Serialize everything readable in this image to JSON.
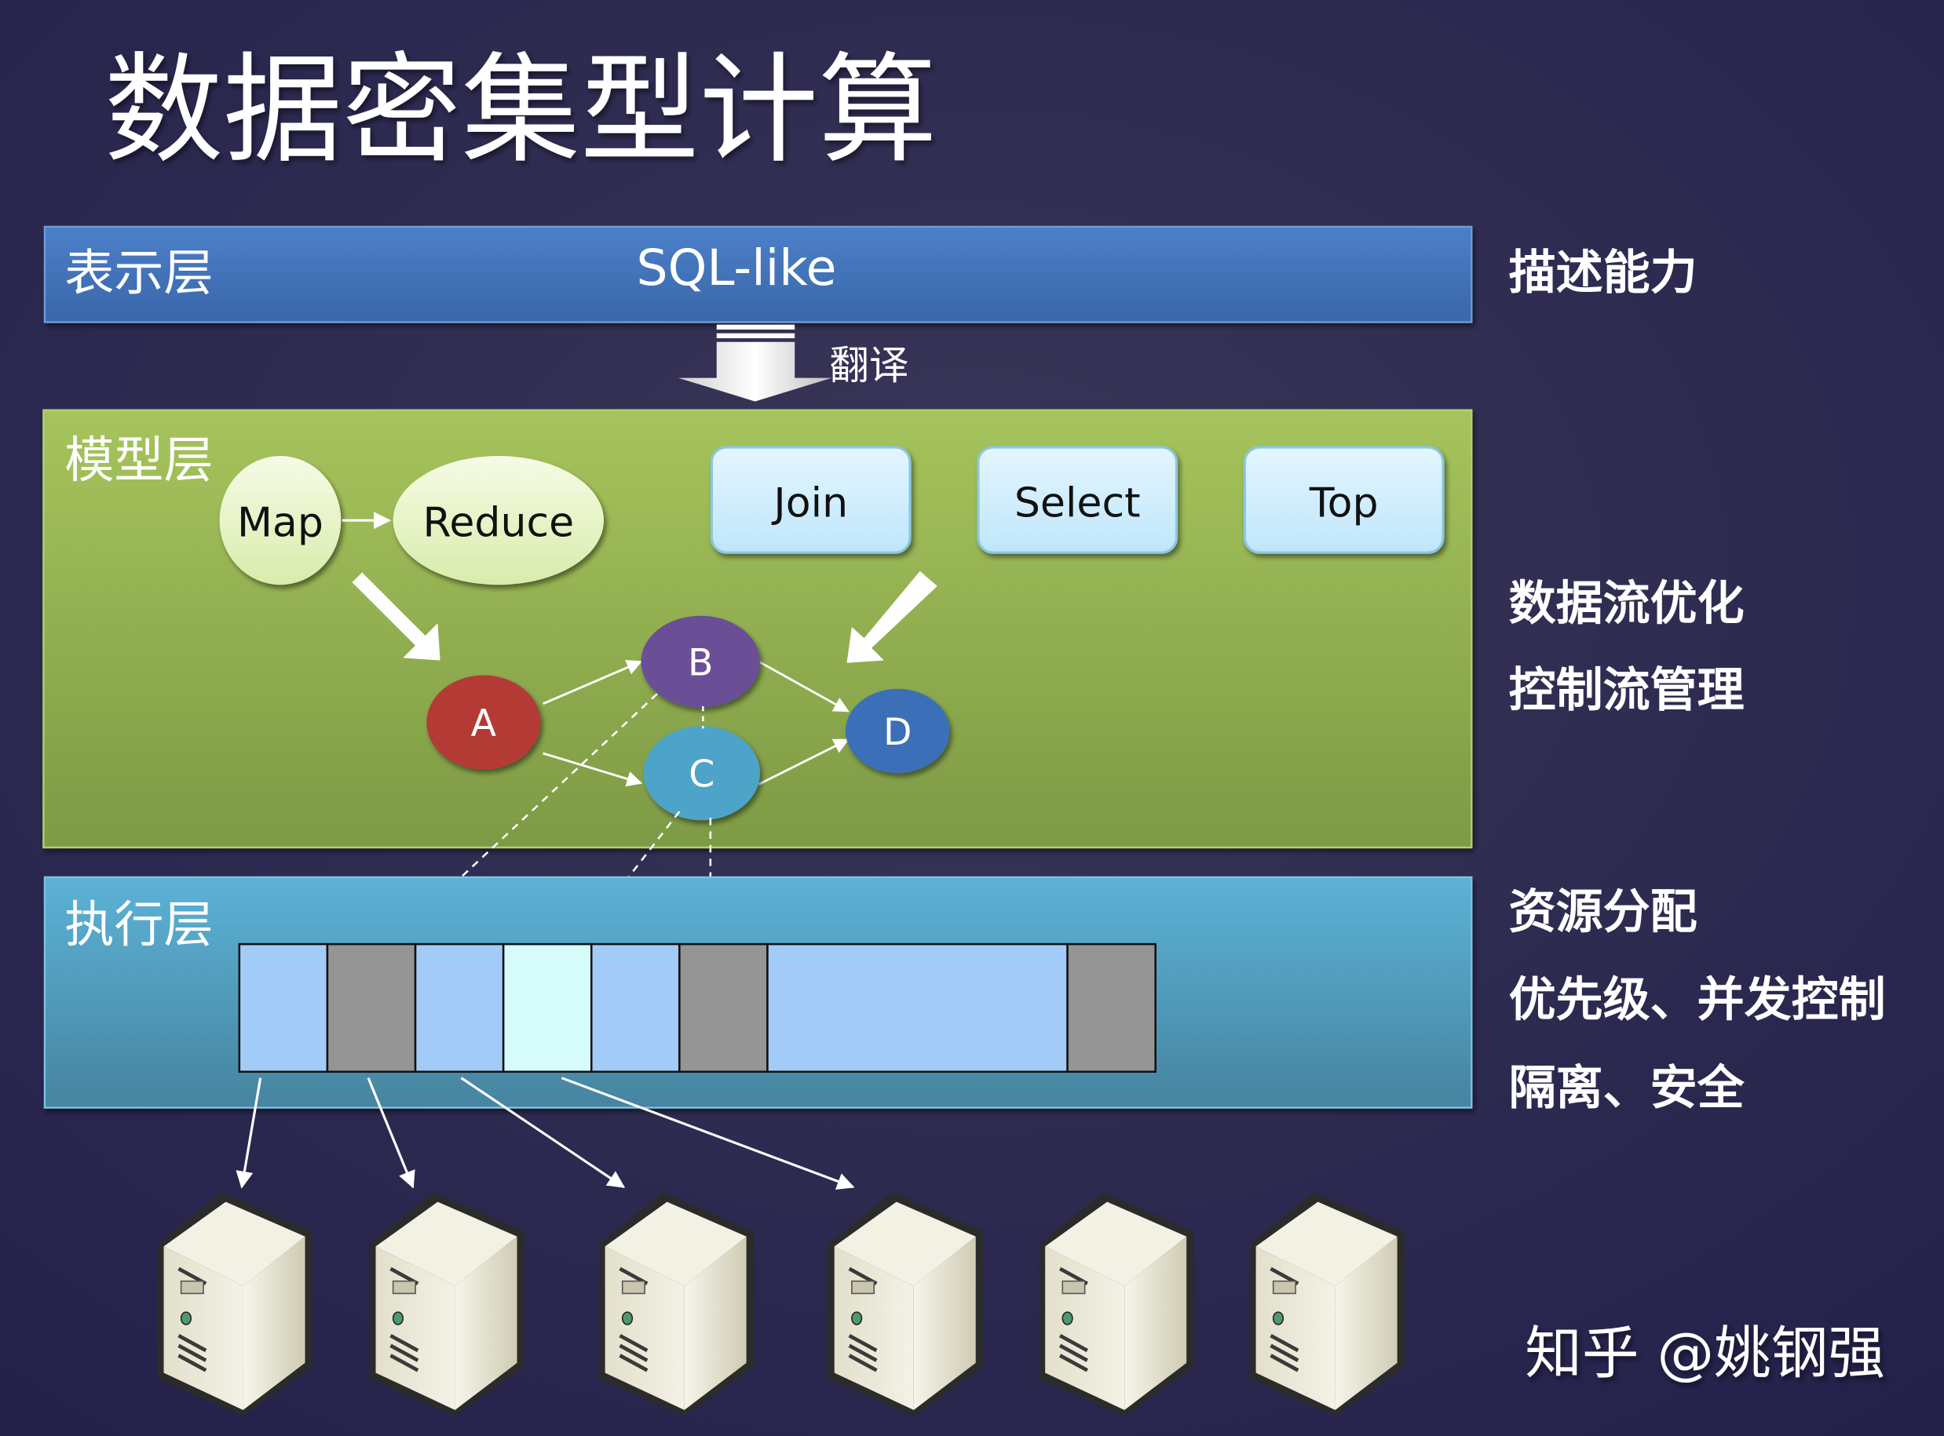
{
  "slide": {
    "title": "数据密集型计算",
    "watermark": "知乎 @姚钢强"
  },
  "layers": {
    "presentation": {
      "label": "表示层",
      "content": "SQL-like",
      "color": "#4a7cc4"
    },
    "translate_label": "翻译",
    "model": {
      "label": "模型层",
      "color": "#8ea94a",
      "mapreduce": [
        "Map",
        "Reduce"
      ],
      "operators": [
        "Join",
        "Select",
        "Top"
      ],
      "dag_nodes": [
        {
          "id": "A",
          "color": "#b43a36"
        },
        {
          "id": "B",
          "color": "#6a4f96"
        },
        {
          "id": "C",
          "color": "#4ea4c8"
        },
        {
          "id": "D",
          "color": "#3a6fb8"
        }
      ],
      "dag_edges": [
        [
          "A",
          "B"
        ],
        [
          "A",
          "C"
        ],
        [
          "B",
          "D"
        ],
        [
          "C",
          "D"
        ]
      ]
    },
    "execution": {
      "label": "执行层",
      "color": "#54a6c8",
      "slots": [
        "free",
        "busy",
        "free",
        "highlight",
        "free",
        "busy",
        "free-wide",
        "busy"
      ]
    }
  },
  "capabilities": {
    "presentation": [
      "描述能力"
    ],
    "model": [
      "数据流优化",
      "控制流管理"
    ],
    "execution": [
      "资源分配",
      "优先级、并发控制",
      "隔离、安全"
    ]
  },
  "servers": {
    "count": 6
  }
}
